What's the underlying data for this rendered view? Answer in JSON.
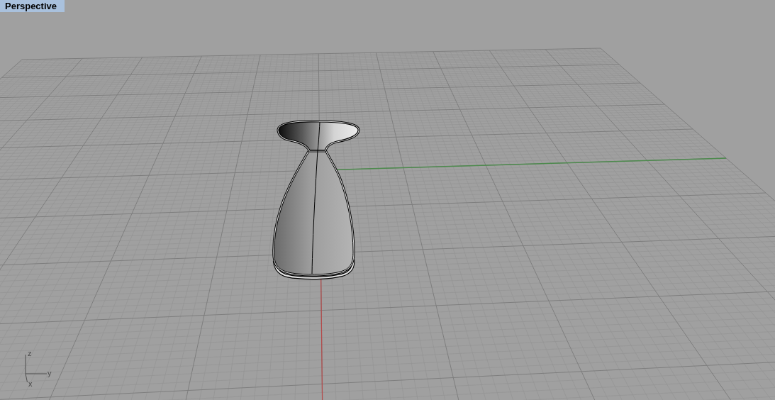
{
  "viewport": {
    "title": "Perspective",
    "active": true
  },
  "axis_icon": {
    "labels": [
      {
        "kind": "vertical",
        "text": "z"
      },
      {
        "kind": "horizontal",
        "text": "y"
      },
      {
        "kind": "depth",
        "text": "x"
      }
    ]
  }
}
